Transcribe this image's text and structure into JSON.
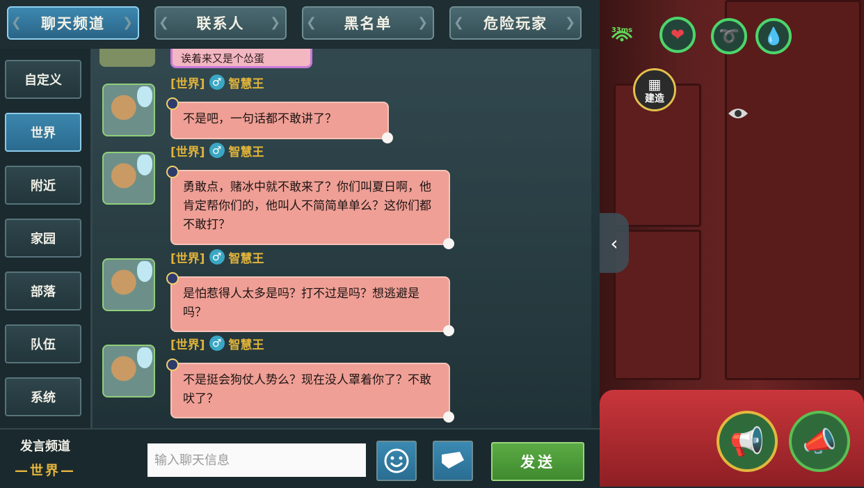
{
  "tabs": [
    "聊天频道",
    "联系人",
    "黑名单",
    "危险玩家"
  ],
  "active_tab": 0,
  "side_channels": [
    "自定义",
    "世界",
    "附近",
    "家园",
    "部落",
    "队伍",
    "系统"
  ],
  "active_channel": 1,
  "partial_message": "诶着来又是个怂蛋",
  "messages": [
    {
      "channel": "[世界]",
      "gender": "♂",
      "name": "智慧王",
      "text": "不是吧，一句话都不敢讲了？"
    },
    {
      "channel": "[世界]",
      "gender": "♂",
      "name": "智慧王",
      "text": "勇敢点，赌冰中就不敢来了？你们叫夏日啊，他肯定帮你们的，他叫人不简简单单么？这你们都不敢打？"
    },
    {
      "channel": "[世界]",
      "gender": "♂",
      "name": "智慧王",
      "text": "是怕惹得人太多是吗？打不过是吗？想逃避是吗？"
    },
    {
      "channel": "[世界]",
      "gender": "♂",
      "name": "智慧王",
      "text": "不是挺会狗仗人势么？现在没人罩着你了？不敢吠了？"
    }
  ],
  "bottom": {
    "channel_label": "发言频道",
    "channel_current": "—世界—",
    "input_placeholder": "输入聊天信息",
    "send_label": "发送"
  },
  "hud": {
    "ping": "33ms",
    "build_label": "建造",
    "stats_colors": {
      "health": "#e8414a",
      "hunger": "#e8c23a",
      "water": "#3ab3e0"
    }
  }
}
